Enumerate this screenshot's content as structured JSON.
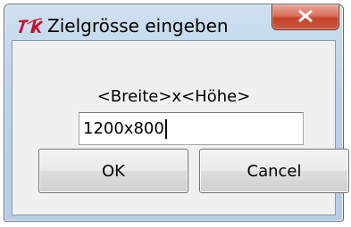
{
  "window": {
    "title": "Zielgrösse eingeben",
    "app_icon": "tk-feather-icon",
    "close_icon": "close-icon"
  },
  "dialog": {
    "prompt": "<Breite>x<Höhe>",
    "entry_value": "1200x800",
    "ok_label": "OK",
    "cancel_label": "Cancel"
  },
  "colors": {
    "close_button": "#c7452c",
    "client_background": "#f0f0f0",
    "frame": "#bcd2ea"
  }
}
